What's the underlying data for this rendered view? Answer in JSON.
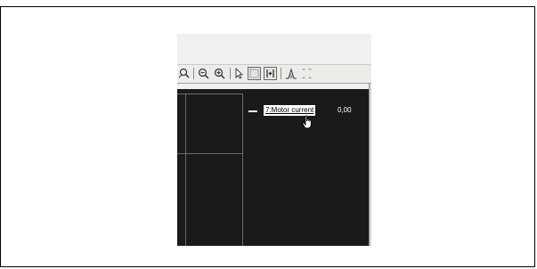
{
  "toolbar": {
    "buttons": [
      {
        "icon": "zoom-fit-icon",
        "glyph": "🔍"
      },
      {
        "icon": "zoom-out-icon",
        "glyph": "⊖"
      },
      {
        "icon": "zoom-in-icon",
        "glyph": "⊕"
      },
      {
        "icon": "pointer-icon",
        "glyph": "↖"
      },
      {
        "icon": "select-rectangle-icon"
      },
      {
        "icon": "cursors-icon"
      },
      {
        "icon": "trigger-icon"
      },
      {
        "icon": "expand-icon"
      }
    ]
  },
  "legend": {
    "channel_label": "7:Motor current",
    "channel_value": "0,00",
    "line_color": "#ffffff"
  },
  "plot": {
    "background": "#1a1a1a",
    "grid_color": "#6b6b6b"
  },
  "figure_id": "130BT470.10"
}
